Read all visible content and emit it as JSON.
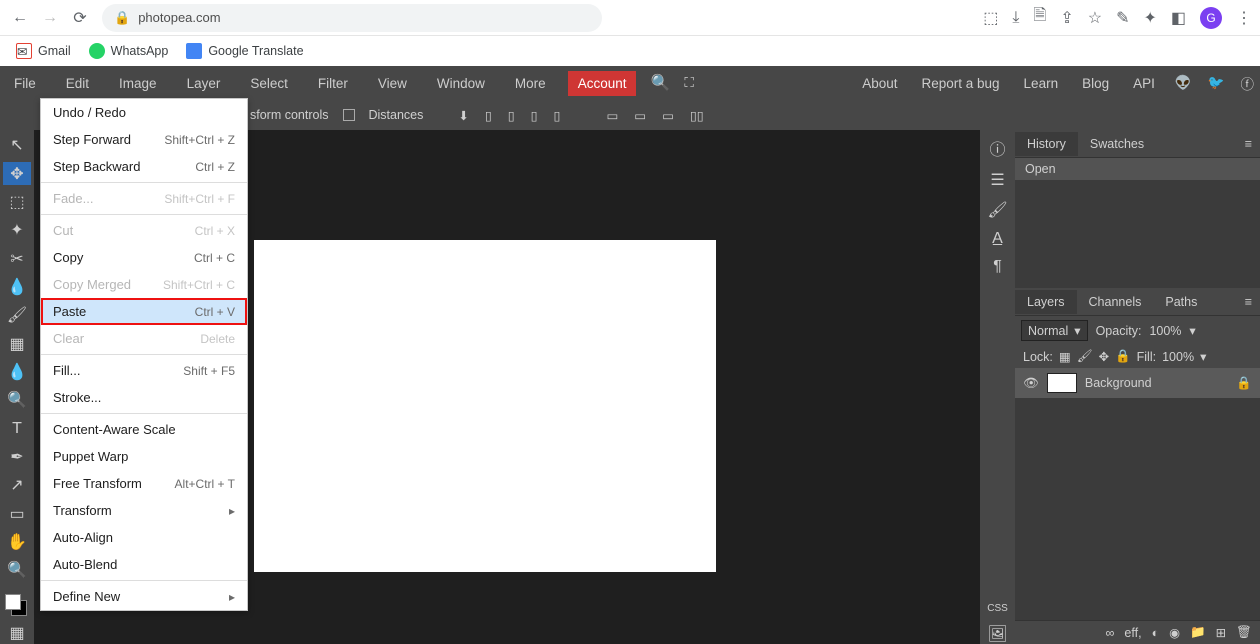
{
  "browser": {
    "url_host": "photopea.com",
    "avatar_letter": "G",
    "bookmarks": [
      {
        "label": "Gmail",
        "color": "#e34133"
      },
      {
        "label": "WhatsApp",
        "color": "#25d366"
      },
      {
        "label": "Google Translate",
        "color": "#4285f4"
      }
    ]
  },
  "menubar": {
    "items": [
      "File",
      "Edit",
      "Image",
      "Layer",
      "Select",
      "Filter",
      "View",
      "Window",
      "More"
    ],
    "account": "Account",
    "right": [
      "About",
      "Report a bug",
      "Learn",
      "Blog",
      "API"
    ]
  },
  "optionbar": {
    "transform": "sform controls",
    "distances": "Distances"
  },
  "edit_menu": {
    "items": [
      {
        "label": "Undo / Redo",
        "key": "",
        "type": "item"
      },
      {
        "label": "Step Forward",
        "key": "Shift+Ctrl + Z",
        "type": "item"
      },
      {
        "label": "Step Backward",
        "key": "Ctrl + Z",
        "type": "item"
      },
      {
        "type": "sep"
      },
      {
        "label": "Fade...",
        "key": "Shift+Ctrl + F",
        "type": "disabled"
      },
      {
        "type": "sep"
      },
      {
        "label": "Cut",
        "key": "Ctrl + X",
        "type": "disabled"
      },
      {
        "label": "Copy",
        "key": "Ctrl + C",
        "type": "item"
      },
      {
        "label": "Copy Merged",
        "key": "Shift+Ctrl + C",
        "type": "disabled"
      },
      {
        "label": "Paste",
        "key": "Ctrl + V",
        "type": "highlighted"
      },
      {
        "label": "Clear",
        "key": "Delete",
        "type": "disabled"
      },
      {
        "type": "sep"
      },
      {
        "label": "Fill...",
        "key": "Shift + F5",
        "type": "item"
      },
      {
        "label": "Stroke...",
        "key": "",
        "type": "item"
      },
      {
        "type": "sep"
      },
      {
        "label": "Content-Aware Scale",
        "key": "",
        "type": "item"
      },
      {
        "label": "Puppet Warp",
        "key": "",
        "type": "item"
      },
      {
        "label": "Free Transform",
        "key": "Alt+Ctrl + T",
        "type": "item"
      },
      {
        "label": "Transform",
        "key": "▸",
        "type": "item"
      },
      {
        "label": "Auto-Align",
        "key": "",
        "type": "item"
      },
      {
        "label": "Auto-Blend",
        "key": "",
        "type": "item"
      },
      {
        "type": "sep"
      },
      {
        "label": "Define New",
        "key": "▸",
        "type": "item"
      }
    ]
  },
  "panels": {
    "history_tabs": [
      "History",
      "Swatches"
    ],
    "history_item": "Open",
    "layer_tabs": [
      "Layers",
      "Channels",
      "Paths"
    ],
    "blend": "Normal",
    "opacity_label": "Opacity:",
    "opacity_val": "100%",
    "lock_label": "Lock:",
    "fill_label": "Fill:",
    "fill_val": "100%",
    "layer_name": "Background",
    "foot_label": "eff,"
  },
  "tools": [
    "arrow",
    "move",
    "marquee",
    "wand",
    "crop",
    "eyedrop",
    "brush",
    "grad",
    "blur",
    "sponge",
    "type",
    "pen",
    "path",
    "rect",
    "hand",
    "zoom"
  ]
}
